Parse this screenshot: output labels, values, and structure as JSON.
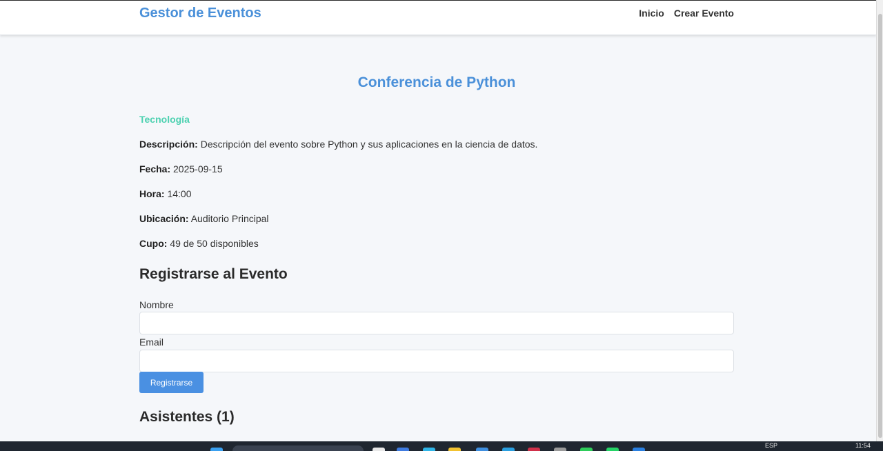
{
  "navbar": {
    "brand": "Gestor de Eventos",
    "links": [
      "Inicio",
      "Crear Evento"
    ]
  },
  "event": {
    "title": "Conferencia de Python",
    "category": "Tecnología",
    "details": [
      {
        "label": "Descripción:",
        "value": "Descripción del evento sobre Python y sus aplicaciones en la ciencia de datos."
      },
      {
        "label": "Fecha:",
        "value": "2025-09-15"
      },
      {
        "label": "Hora:",
        "value": "14:00"
      },
      {
        "label": "Ubicación:",
        "value": "Auditorio Principal"
      },
      {
        "label": "Cupo:",
        "value": "49 de 50 disponibles"
      }
    ]
  },
  "registration": {
    "title": "Registrarse al Evento",
    "name_label": "Nombre",
    "name_value": "",
    "email_label": "Email",
    "email_value": "",
    "submit_label": "Registrarse"
  },
  "attendees": {
    "title": "Asistentes (1)"
  },
  "taskbar": {
    "lang": "ESP",
    "time": "11:54",
    "accent": "#1f2630"
  },
  "colors": {
    "brand": "#4a90d9",
    "category": "#4cd1b0",
    "button": "#4a90e2",
    "background": "#f5f7fa"
  }
}
